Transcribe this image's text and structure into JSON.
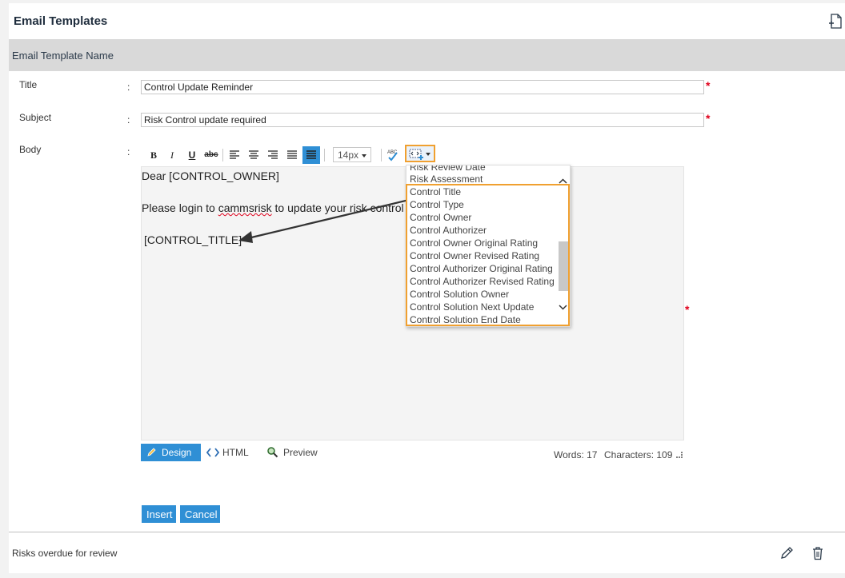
{
  "header": {
    "title": "Email Templates",
    "new_icon": "new-document-icon"
  },
  "section": {
    "title": "Email Template Name"
  },
  "form": {
    "title_label": "Title",
    "title_value": "Control Update Reminder",
    "subject_label": "Subject",
    "subject_value": "Risk Control update required",
    "body_label": "Body",
    "colon": ":",
    "required_mark": "*"
  },
  "toolbar": {
    "bold": "B",
    "italic": "I",
    "underline": "U",
    "strike": "abc",
    "font_size": "14px",
    "icons": [
      "bold-icon",
      "italic-icon",
      "underline-icon",
      "strikethrough-icon",
      "align-left-icon",
      "align-center-icon",
      "align-right-icon",
      "justify-icon",
      "justify-full-icon",
      "font-size-select",
      "spellcheck-icon",
      "insert-field-icon"
    ]
  },
  "editor": {
    "line1": "Dear [CONTROL_OWNER]",
    "line2_pre": "Please login to ",
    "line2_spell": "cammsrisk",
    "line2_post": " to update your risk control",
    "line3": "[CONTROL_TITLE]"
  },
  "field_menu": {
    "items": [
      "Risk Review Date",
      "Risk Assessment",
      "Control Title",
      "Control Type",
      "Control Owner",
      "Control Authorizer",
      "Control Owner Original Rating",
      "Control Owner Revised Rating",
      "Control Authorizer Original Rating",
      "Control Authorizer Revised Rating",
      "Control Solution Owner",
      "Control Solution Next Update",
      "Control Solution End Date"
    ]
  },
  "modes": {
    "design": "Design",
    "html": "HTML",
    "preview": "Preview"
  },
  "stats": {
    "words_label": "Words: 17",
    "chars_label": "Characters: 109"
  },
  "actions": {
    "insert": "Insert",
    "cancel": "Cancel"
  },
  "list": {
    "row1": "Risks overdue for review"
  },
  "colors": {
    "accent": "#2f8fd5",
    "highlight": "#f0a030",
    "required": "#e0001b",
    "section_bg": "#d9d9d9"
  }
}
